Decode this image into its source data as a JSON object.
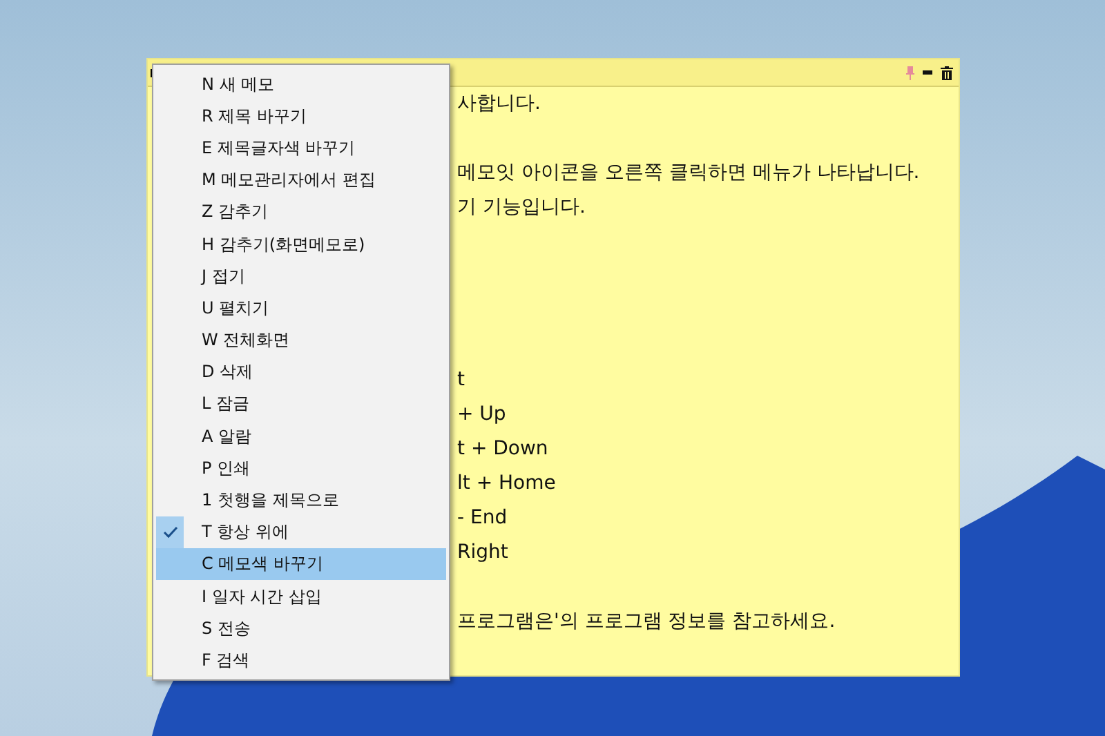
{
  "memo": {
    "lines": [
      {
        "kind": "text",
        "text": "사합니다."
      },
      {
        "kind": "blank"
      },
      {
        "kind": "text",
        "text": "메모잇 아이콘을 오른쪽 클릭하면 메뉴가 나타납니다."
      },
      {
        "kind": "text",
        "text": "기 기능입니다."
      },
      {
        "kind": "blank"
      },
      {
        "kind": "blank"
      },
      {
        "kind": "blank"
      },
      {
        "kind": "blank"
      },
      {
        "kind": "text",
        "text": "t"
      },
      {
        "kind": "text",
        "text": "+ Up"
      },
      {
        "kind": "text",
        "text": "t + Down"
      },
      {
        "kind": "text",
        "text": "lt + Home"
      },
      {
        "kind": "text",
        "text": "- End"
      },
      {
        "kind": "text",
        "text": "Right"
      },
      {
        "kind": "blank"
      },
      {
        "kind": "text",
        "text": "프로그램은'의 프로그램 정보를 참고하세요."
      }
    ]
  },
  "context_menu": {
    "items": [
      {
        "label": "N 새 메모",
        "checked": false,
        "selected": false
      },
      {
        "label": "R 제목 바꾸기",
        "checked": false,
        "selected": false
      },
      {
        "label": "E 제목글자색 바꾸기",
        "checked": false,
        "selected": false
      },
      {
        "label": "M 메모관리자에서 편집",
        "checked": false,
        "selected": false
      },
      {
        "label": "Z 감추기",
        "checked": false,
        "selected": false
      },
      {
        "label": "H 감추기(화면메모로)",
        "checked": false,
        "selected": false
      },
      {
        "label": "J 접기",
        "checked": false,
        "selected": false
      },
      {
        "label": "U 펼치기",
        "checked": false,
        "selected": false
      },
      {
        "label": "W 전체화면",
        "checked": false,
        "selected": false
      },
      {
        "label": "D 삭제",
        "checked": false,
        "selected": false
      },
      {
        "label": "L 잠금",
        "checked": false,
        "selected": false
      },
      {
        "label": "A 알람",
        "checked": false,
        "selected": false
      },
      {
        "label": "P 인쇄",
        "checked": false,
        "selected": false
      },
      {
        "label": "1 첫행을 제목으로",
        "checked": false,
        "selected": false
      },
      {
        "label": "T 항상 위에",
        "checked": true,
        "selected": false
      },
      {
        "label": "C 메모색 바꾸기",
        "checked": false,
        "selected": true
      },
      {
        "label": "I 일자 시간 삽입",
        "checked": false,
        "selected": false
      },
      {
        "label": "S 전송",
        "checked": false,
        "selected": false
      },
      {
        "label": "F 검색",
        "checked": false,
        "selected": false
      }
    ]
  }
}
